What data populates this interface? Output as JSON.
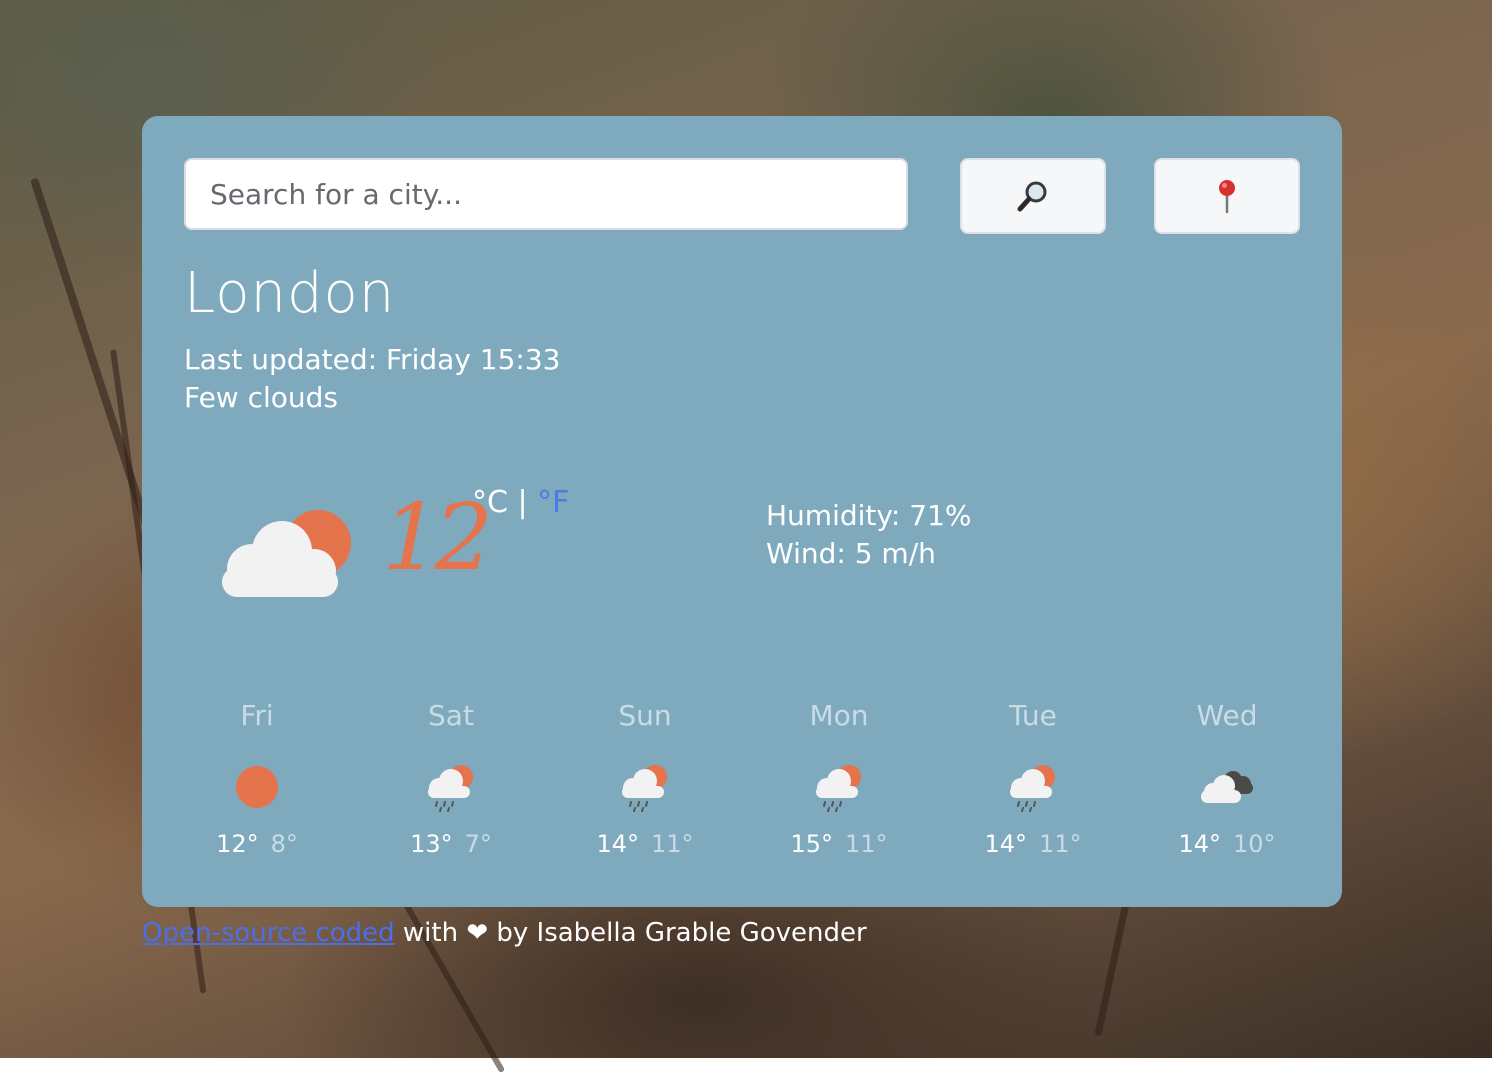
{
  "search": {
    "placeholder": "Search for a city...",
    "search_icon": "magnifier-icon",
    "location_icon": "pushpin-icon"
  },
  "current": {
    "city": "London",
    "last_updated": "Last updated: Friday 15:33",
    "description": "Few clouds",
    "temperature": "12",
    "unit_c": "°C",
    "unit_sep": " | ",
    "unit_f": "°F",
    "humidity": "Humidity: 71%",
    "wind": "Wind: 5 m/h",
    "icon": "few-clouds-icon"
  },
  "forecast": [
    {
      "day": "Fri",
      "max": "12°",
      "min": "8°",
      "icon": "sun-icon"
    },
    {
      "day": "Sat",
      "max": "13°",
      "min": "7°",
      "icon": "rain-sun-icon"
    },
    {
      "day": "Sun",
      "max": "14°",
      "min": "11°",
      "icon": "rain-sun-icon"
    },
    {
      "day": "Mon",
      "max": "15°",
      "min": "11°",
      "icon": "rain-sun-icon"
    },
    {
      "day": "Tue",
      "max": "14°",
      "min": "11°",
      "icon": "rain-sun-icon"
    },
    {
      "day": "Wed",
      "max": "14°",
      "min": "10°",
      "icon": "broken-clouds-icon"
    }
  ],
  "footer": {
    "link_text": "Open-source coded",
    "rest_text": " with ❤ by Isabella Grable Govender"
  },
  "colors": {
    "card": "#7faabe",
    "accent_orange": "#e5734b",
    "link_blue": "#4b6fe8",
    "unit_active": "#4b7be6"
  }
}
